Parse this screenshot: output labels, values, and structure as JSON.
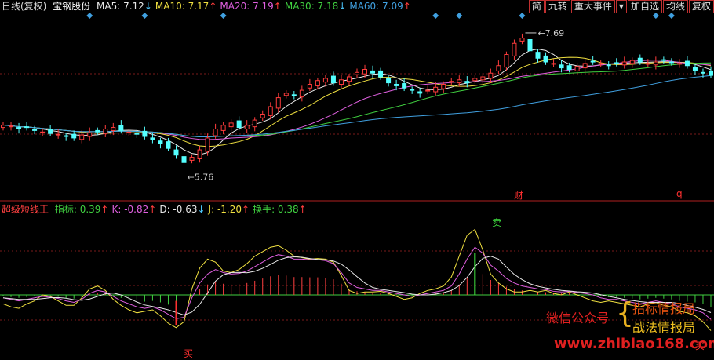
{
  "top_header": {
    "period": "日线(复权)",
    "stock": "宝钢股份",
    "ma": [
      {
        "label": "MA5:",
        "value": "7.12",
        "arrow": "↓",
        "color": "#e8e8e8",
        "dir": "down"
      },
      {
        "label": "MA10:",
        "value": "7.17",
        "arrow": "↑",
        "color": "#f0e040",
        "dir": "up"
      },
      {
        "label": "MA20:",
        "value": "7.19",
        "arrow": "↑",
        "color": "#e060e0",
        "dir": "up"
      },
      {
        "label": "MA30:",
        "value": "7.18",
        "arrow": "↓",
        "color": "#40d040",
        "dir": "down"
      },
      {
        "label": "MA60:",
        "value": "7.09",
        "arrow": "↑",
        "color": "#40a0e0",
        "dir": "up"
      }
    ]
  },
  "toolbar": [
    "简",
    "九转",
    "重大事件",
    "▾",
    "加自选",
    "均线",
    "复权"
  ],
  "price_chart": {
    "high_marker": "7.69",
    "low_marker": "5.76",
    "event_tags": [
      "财",
      "q"
    ],
    "colors": {
      "up": "#ff3c3c",
      "down": "#54ffff"
    }
  },
  "indicator_header": {
    "name": "超级短线王",
    "items": [
      {
        "label": "指标:",
        "value": "0.39",
        "arrow": "↑",
        "color": "#40d040",
        "dir": "up"
      },
      {
        "label": "K:",
        "value": "-0.82",
        "arrow": "↑",
        "color": "#e060e0",
        "dir": "up"
      },
      {
        "label": "D:",
        "value": "-0.63",
        "arrow": "↓",
        "color": "#e8e8e8",
        "dir": "down"
      },
      {
        "label": "J:",
        "value": "-1.20",
        "arrow": "↑",
        "color": "#f0e040",
        "dir": "up"
      },
      {
        "label": "换手:",
        "value": "0.38",
        "arrow": "↑",
        "color": "#40d040",
        "dir": "up"
      }
    ]
  },
  "signals": {
    "sell": "卖",
    "buy": "买"
  },
  "watermark": {
    "left": "微信公众号",
    "right1": "指标情报局",
    "right2": "战法情报局",
    "url": "www.zhibiao168.com"
  },
  "chart_data": {
    "type": "candlestick",
    "y_range": [
      5.5,
      7.9
    ],
    "extremes": {
      "high": 7.69,
      "low": 5.76
    },
    "closes": [
      6.45,
      6.44,
      6.4,
      6.42,
      6.38,
      6.36,
      6.34,
      6.33,
      6.3,
      6.28,
      6.32,
      6.35,
      6.36,
      6.4,
      6.42,
      6.38,
      6.36,
      6.34,
      6.3,
      6.26,
      6.2,
      6.14,
      6.05,
      5.95,
      6.02,
      6.12,
      6.28,
      6.4,
      6.45,
      6.48,
      6.42,
      6.45,
      6.52,
      6.6,
      6.7,
      6.82,
      6.88,
      6.85,
      6.92,
      7.0,
      7.05,
      7.08,
      7.02,
      7.06,
      7.1,
      7.16,
      7.2,
      7.15,
      7.1,
      7.02,
      6.98,
      6.95,
      6.92,
      6.88,
      6.92,
      6.96,
      7.0,
      7.04,
      7.06,
      7.02,
      7.08,
      7.1,
      7.15,
      7.25,
      7.4,
      7.55,
      7.62,
      7.45,
      7.35,
      7.3,
      7.28,
      7.22,
      7.2,
      7.24,
      7.28,
      7.3,
      7.28,
      7.26,
      7.28,
      7.3,
      7.32,
      7.3,
      7.28,
      7.3,
      7.32,
      7.3,
      7.28,
      7.25,
      7.18,
      7.15,
      7.12
    ],
    "indicator": {
      "k": [
        -0.1,
        -0.15,
        -0.2,
        -0.15,
        -0.1,
        -0.05,
        -0.08,
        -0.12,
        -0.2,
        -0.25,
        -0.15,
        0.05,
        0.15,
        0.1,
        -0.05,
        -0.2,
        -0.3,
        -0.4,
        -0.45,
        -0.4,
        -0.5,
        -0.65,
        -0.8,
        -0.75,
        -0.1,
        0.4,
        0.7,
        0.85,
        0.75,
        0.7,
        0.72,
        0.8,
        0.95,
        1.1,
        1.25,
        1.35,
        1.3,
        1.2,
        1.2,
        1.18,
        1.18,
        1.15,
        1.05,
        0.75,
        0.4,
        0.25,
        0.2,
        0.15,
        0.15,
        0.1,
        0.05,
        0.0,
        -0.05,
        0.0,
        0.05,
        0.1,
        0.15,
        0.3,
        0.7,
        1.2,
        1.6,
        1.4,
        1.0,
        0.8,
        0.55,
        0.4,
        0.3,
        0.25,
        0.2,
        0.18,
        0.12,
        0.1,
        0.12,
        0.08,
        0.05,
        0.0,
        -0.1,
        -0.15,
        -0.15,
        -0.2,
        -0.25,
        -0.3,
        -0.25,
        -0.2,
        -0.25,
        -0.3,
        -0.4,
        -0.45,
        -0.5,
        -0.6,
        -0.82
      ],
      "j": [
        -0.3,
        -0.4,
        -0.45,
        -0.3,
        -0.2,
        0.0,
        -0.05,
        -0.2,
        -0.35,
        -0.35,
        -0.1,
        0.2,
        0.3,
        0.15,
        -0.15,
        -0.35,
        -0.5,
        -0.6,
        -0.55,
        -0.5,
        -0.7,
        -0.95,
        -1.1,
        -0.9,
        0.2,
        0.9,
        1.2,
        1.1,
        0.8,
        0.75,
        0.85,
        1.05,
        1.3,
        1.45,
        1.6,
        1.65,
        1.5,
        1.3,
        1.25,
        1.2,
        1.22,
        1.2,
        1.1,
        0.65,
        0.15,
        0.05,
        0.1,
        0.1,
        0.12,
        0.05,
        -0.05,
        -0.15,
        -0.1,
        0.05,
        0.15,
        0.2,
        0.3,
        0.6,
        1.3,
        2.0,
        2.2,
        1.5,
        0.7,
        0.4,
        0.2,
        0.1,
        0.1,
        0.15,
        0.1,
        0.15,
        0.05,
        0.0,
        0.1,
        0.0,
        -0.1,
        -0.2,
        -0.25,
        -0.2,
        -0.25,
        -0.3,
        -0.35,
        -0.4,
        -0.3,
        -0.25,
        -0.35,
        -0.4,
        -0.55,
        -0.6,
        -0.7,
        -0.9,
        -1.2
      ]
    }
  }
}
